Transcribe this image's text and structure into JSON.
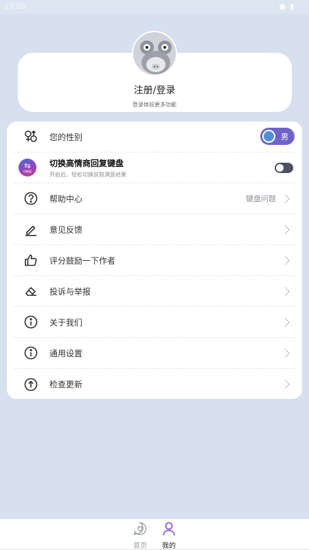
{
  "status": {
    "time": "17:00"
  },
  "profile": {
    "title": "注册/登录",
    "subtitle": "登录体验更多功能"
  },
  "menu": {
    "gender": {
      "label": "您的性别",
      "value": "男"
    },
    "keyboard_switch": {
      "title": "切换高情商回复键盘",
      "desc": "开启后，轻松切换获取满意结果",
      "icon_text": "切键盘",
      "enabled": false
    },
    "items": [
      {
        "label": "帮助中心",
        "value": "键盘问题",
        "icon": "help-circle-icon"
      },
      {
        "label": "意见反馈",
        "value": "",
        "icon": "edit-icon"
      },
      {
        "label": "评分鼓励一下作者",
        "value": "",
        "icon": "thumbs-up-icon"
      },
      {
        "label": "投诉与举报",
        "value": "",
        "icon": "eraser-icon"
      },
      {
        "label": "关于我们",
        "value": "",
        "icon": "info-icon"
      },
      {
        "label": "通用设置",
        "value": "",
        "icon": "info-icon"
      },
      {
        "label": "检查更新",
        "value": "",
        "icon": "upload-icon"
      }
    ]
  },
  "nav": {
    "home_label": "首页",
    "mine_label": "我的"
  },
  "colors": {
    "background": "#d7e0ee",
    "accent": "#6d63c8",
    "toggle_off": "#4d4f63"
  }
}
